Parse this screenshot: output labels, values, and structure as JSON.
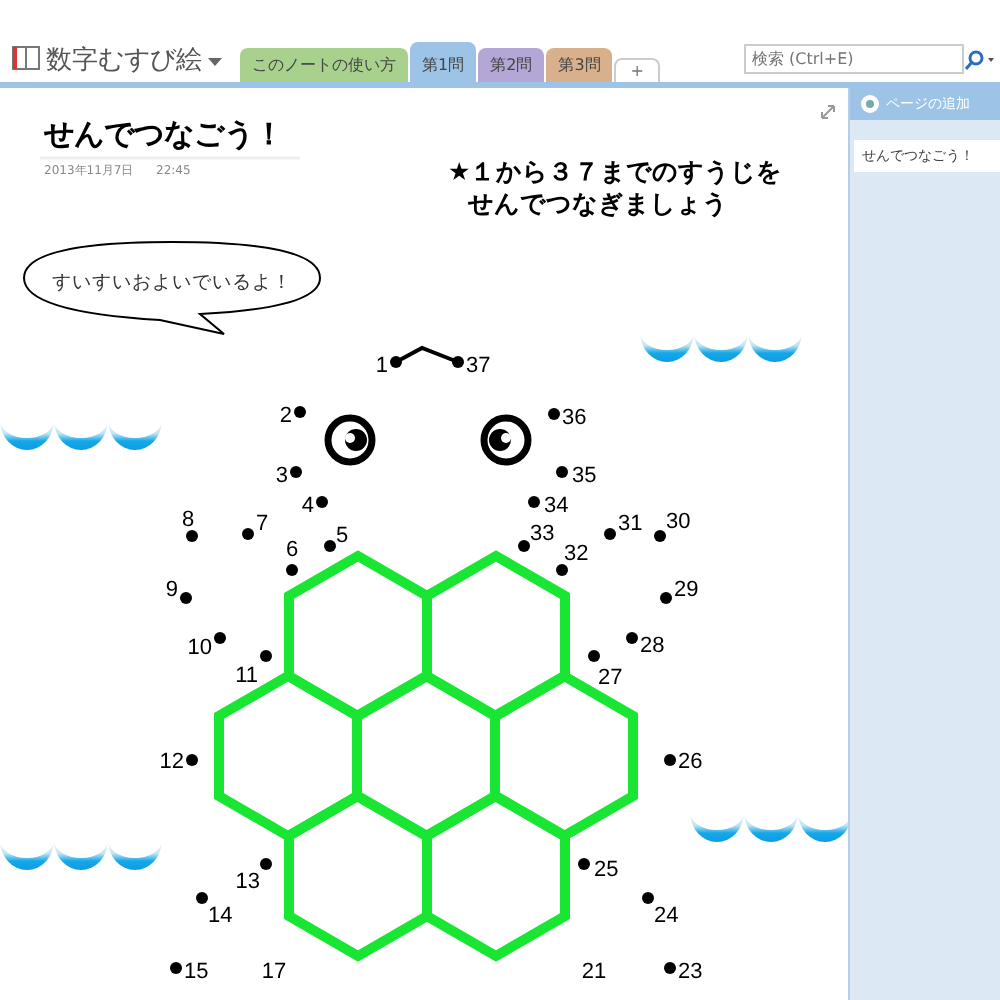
{
  "notebook": {
    "name": "数字むすび絵"
  },
  "section_tabs": [
    {
      "label": "このノートの使い方",
      "selected": false,
      "color": "#a9d18e",
      "kind": "section"
    },
    {
      "label": "第1問",
      "selected": true,
      "color": "#9dc3e6",
      "kind": "section"
    },
    {
      "label": "第2問",
      "selected": false,
      "color": "#b4a7d6",
      "kind": "section"
    },
    {
      "label": "第3問",
      "selected": false,
      "color": "#d9b08c",
      "kind": "section"
    },
    {
      "label": "+",
      "selected": false,
      "kind": "new"
    }
  ],
  "search": {
    "placeholder": "検索 (Ctrl+E)"
  },
  "page": {
    "title": "せんでつなごう！",
    "date": "2013年11月7日",
    "time": "22:45",
    "instruction_lines": [
      "★１から３７までのすうじを",
      "せんでつなぎましょう"
    ],
    "speech_bubble": "すいすいおよいでいるよ！",
    "left_dots": [
      {
        "label": "1"
      },
      {
        "label": "2"
      },
      {
        "label": "3"
      },
      {
        "label": "4"
      },
      {
        "label": "5"
      },
      {
        "label": "6"
      },
      {
        "label": "8"
      },
      {
        "label": "7"
      },
      {
        "label": "9"
      },
      {
        "label": "10"
      },
      {
        "label": "11"
      },
      {
        "label": "12"
      },
      {
        "label": "13"
      },
      {
        "label": "14"
      },
      {
        "label": "15"
      },
      {
        "label": "17"
      }
    ],
    "right_dots": [
      {
        "label": "37"
      },
      {
        "label": "36"
      },
      {
        "label": "35"
      },
      {
        "label": "34"
      },
      {
        "label": "31"
      },
      {
        "label": "30"
      },
      {
        "label": "33"
      },
      {
        "label": "32"
      },
      {
        "label": "29"
      },
      {
        "label": "28"
      },
      {
        "label": "27"
      },
      {
        "label": "26"
      },
      {
        "label": "25"
      },
      {
        "label": "24"
      },
      {
        "label": "23"
      },
      {
        "label": "21"
      }
    ]
  },
  "page_panel": {
    "add_page": "ページの追加",
    "pages": [
      {
        "title": "せんでつなごう！",
        "selected": true
      }
    ]
  }
}
